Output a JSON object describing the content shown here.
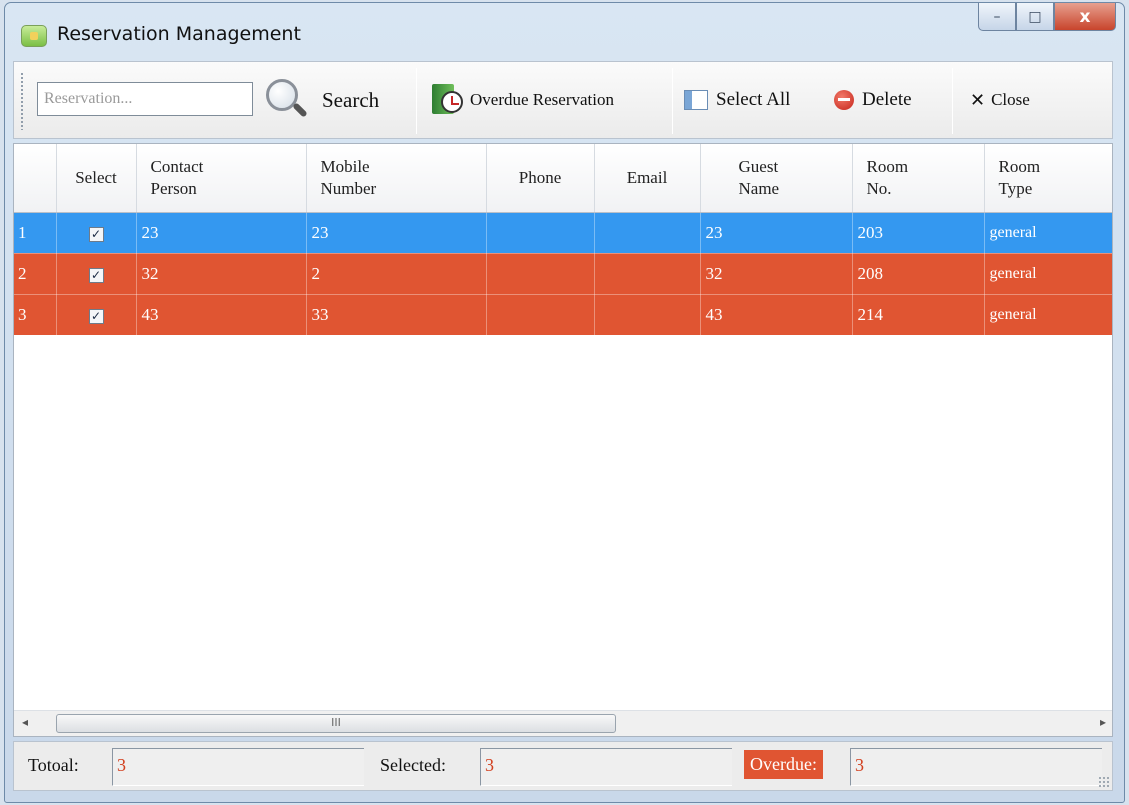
{
  "window": {
    "title": "Reservation Management",
    "controls": {
      "minimize": "–",
      "maximize": "□",
      "close": "x"
    }
  },
  "toolbar": {
    "search_placeholder": "Reservation...",
    "search_value": "",
    "search_label": "Search",
    "overdue_label": "Overdue Reservation",
    "select_all_label": "Select All",
    "delete_label": "Delete",
    "close_label": "Close"
  },
  "grid": {
    "columns": {
      "select": "Select",
      "contact_person": [
        "Contact",
        "Person"
      ],
      "mobile_number": [
        "Mobile",
        "Number"
      ],
      "phone": "Phone",
      "email": "Email",
      "guest_name": [
        "Guest",
        "Name"
      ],
      "room_no": [
        "Room",
        "No."
      ],
      "room_type": [
        "Room",
        "Type"
      ]
    },
    "rows": [
      {
        "index": "1",
        "checked": true,
        "contact": "23",
        "mobile": "23",
        "phone": "",
        "email": "",
        "guest": "23",
        "room": "203",
        "type": "general",
        "state": "selected"
      },
      {
        "index": "2",
        "checked": true,
        "contact": "32",
        "mobile": "2",
        "phone": "",
        "email": "",
        "guest": "32",
        "room": "208",
        "type": "general",
        "state": "overdue"
      },
      {
        "index": "3",
        "checked": true,
        "contact": "43",
        "mobile": "33",
        "phone": "",
        "email": "",
        "guest": "43",
        "room": "214",
        "type": "general",
        "state": "overdue"
      }
    ],
    "scrollbar": {
      "thumb_grip": "III",
      "left_arrow": "◂",
      "right_arrow": "▸"
    }
  },
  "status": {
    "total_label": "Totoal:",
    "total_value": "3",
    "selected_label": "Selected:",
    "selected_value": "3",
    "overdue_label": "Overdue:",
    "overdue_value": "3"
  },
  "colors": {
    "selected_row": "#3498f0",
    "overdue_row": "#e05532",
    "status_value": "#d2401f"
  }
}
